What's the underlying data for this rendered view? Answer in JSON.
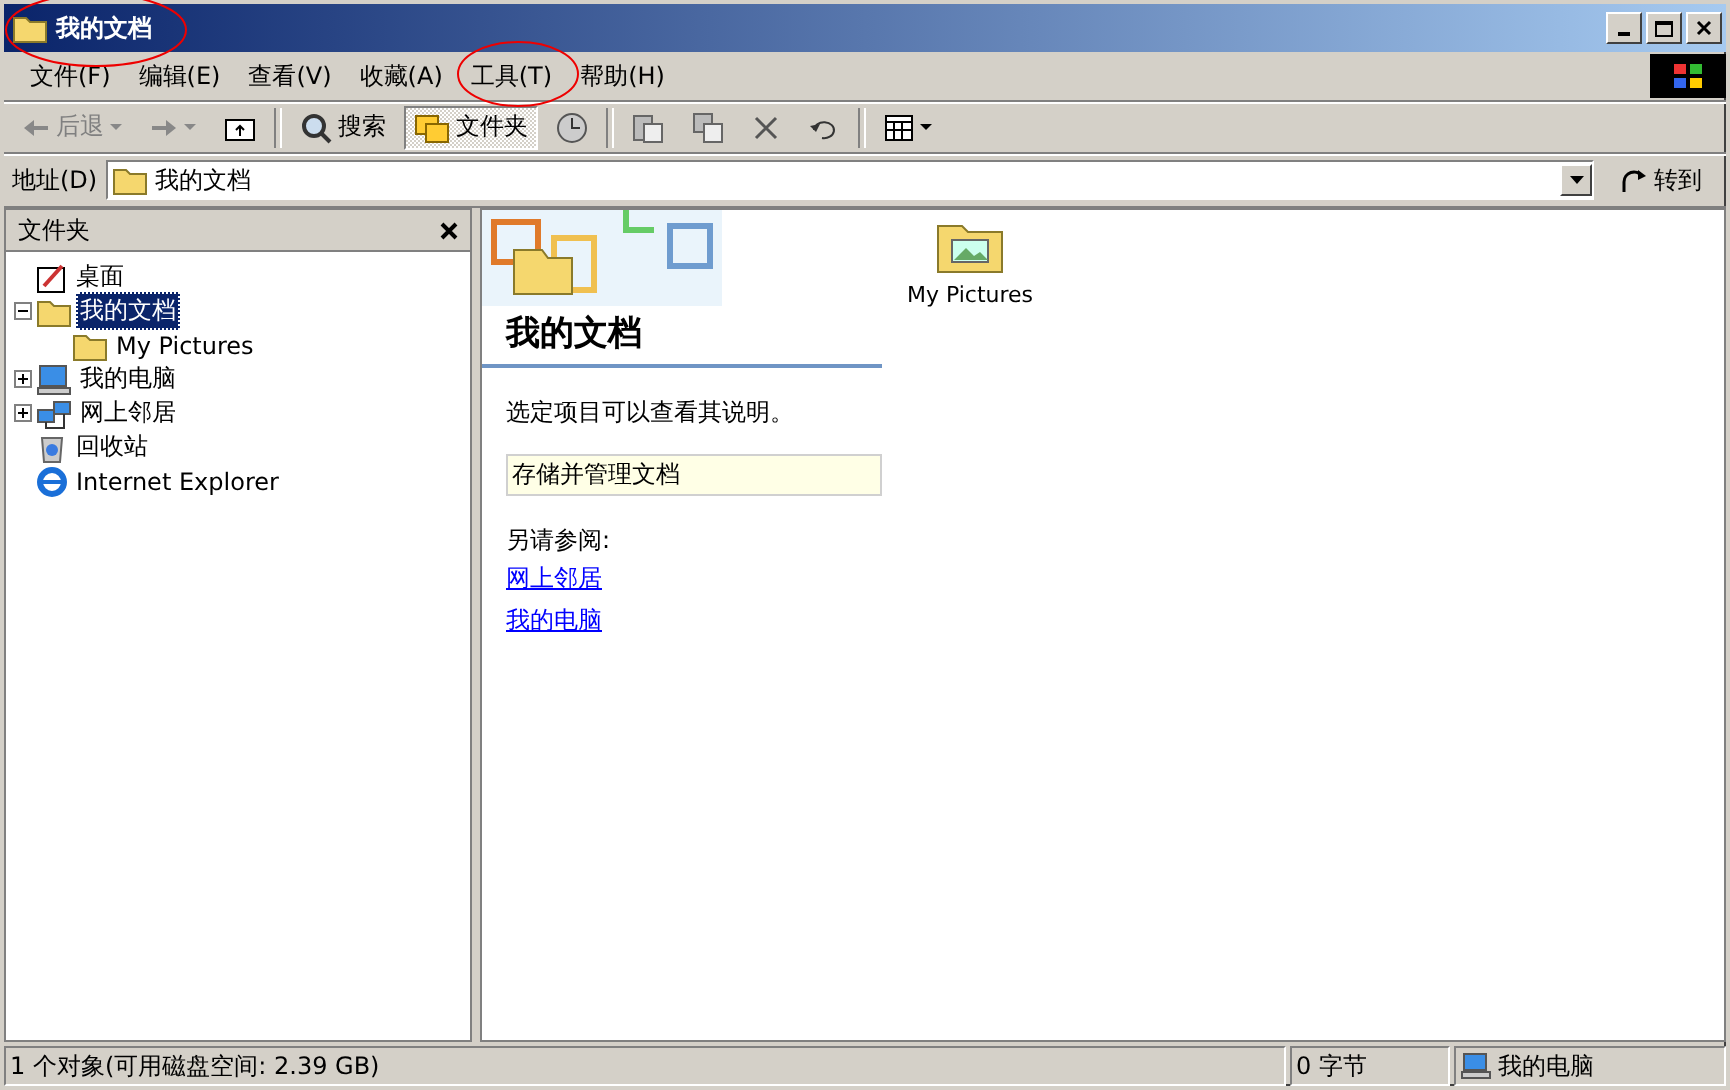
{
  "window": {
    "title": "我的文档",
    "circled": true
  },
  "menu": [
    {
      "label": "文件(F)",
      "circled": false
    },
    {
      "label": "编辑(E)",
      "circled": false
    },
    {
      "label": "查看(V)",
      "circled": false
    },
    {
      "label": "收藏(A)",
      "circled": false
    },
    {
      "label": "工具(T)",
      "circled": true
    },
    {
      "label": "帮助(H)",
      "circled": false
    }
  ],
  "toolbar": {
    "back": {
      "label": "后退",
      "disabled": true
    },
    "search": {
      "label": "搜索"
    },
    "folders": {
      "label": "文件夹",
      "selected": true
    }
  },
  "address": {
    "label": "地址(D)",
    "value": "我的文档",
    "go": "转到"
  },
  "folder_pane": {
    "title": "文件夹",
    "tree": [
      {
        "label": "桌面",
        "kind": "desktop",
        "selected": false,
        "children": [
          {
            "label": "我的文档",
            "kind": "documents",
            "expanded": true,
            "selected": true,
            "children": [
              {
                "label": "My Pictures",
                "kind": "pictures",
                "selected": false
              }
            ]
          },
          {
            "label": "我的电脑",
            "kind": "computer",
            "expanded": false,
            "selected": false
          },
          {
            "label": "网上邻居",
            "kind": "network",
            "expanded": false,
            "selected": false
          },
          {
            "label": "回收站",
            "kind": "recycle",
            "selected": false
          },
          {
            "label": "Internet Explorer",
            "kind": "browser",
            "selected": false
          }
        ]
      }
    ]
  },
  "task_pane": {
    "heading": "我的文档",
    "hint": "选定项目可以查看其说明。",
    "info": "存储并管理文档",
    "see_also": "另请参阅:",
    "links": [
      "网上邻居",
      "我的电脑"
    ]
  },
  "files": [
    {
      "label": "My Pictures"
    }
  ],
  "status_bar": {
    "objects": "1 个对象(可用磁盘空间: 2.39 GB)",
    "size": "0 字节",
    "location": "我的电脑"
  }
}
